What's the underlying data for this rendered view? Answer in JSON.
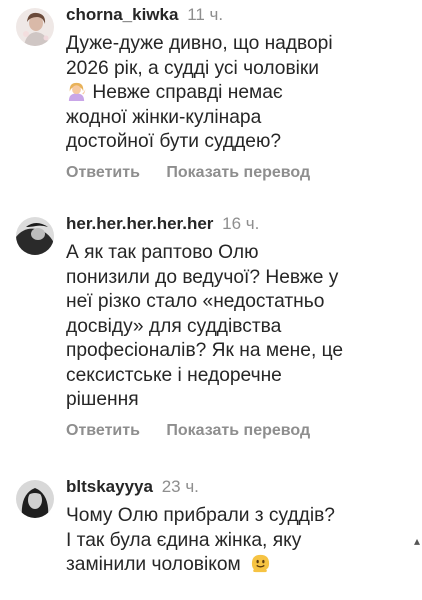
{
  "comments": [
    {
      "username": "chorna_kiwka",
      "time": "11 ч.",
      "lines": [
        "Дуже-дуже дивно, що надворі",
        "2026 рік, а судді усі чоловіки",
        "Невже справді немає",
        "жодної жінки-кулінара",
        "достойної бути суддею?"
      ],
      "emoji_icon": "woman-tipping-hand-emoji",
      "reply_label": "Ответить",
      "translate_label": "Показать перевод"
    },
    {
      "username": "her.her.her.her.her",
      "time": "16 ч.",
      "lines": [
        "А як так раптово Олю",
        "понизили до ведучої? Невже у",
        "неї різко стало «недостатньо",
        "досвіду» для суддівства",
        "професіоналів? Як на мене, це",
        "сексистське і недоречне",
        "рішення"
      ],
      "reply_label": "Ответить",
      "translate_label": "Показать перевод"
    },
    {
      "username": "bltskayyya",
      "time": "23 ч.",
      "lines": [
        "Чому Олю прибрали з суддів?",
        "І так була єдина жінка, яку",
        "замінили чоловіком"
      ],
      "emoji_icon": "melting-face-emoji"
    }
  ],
  "colors": {
    "text": "#262626",
    "secondary": "#8e8e8e",
    "background": "#ffffff"
  }
}
